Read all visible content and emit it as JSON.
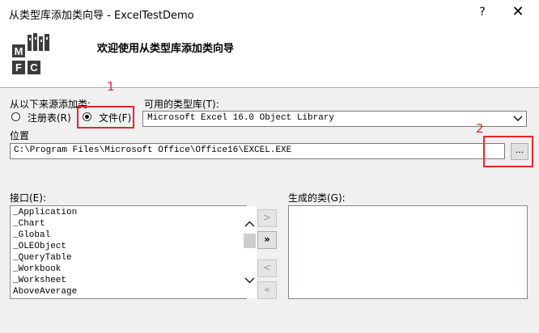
{
  "window": {
    "title": "从类型库添加类向导 - ExcelTestDemo",
    "help_glyph": "?",
    "close_glyph": "✕"
  },
  "header": {
    "title": "欢迎使用从类型库添加类向导",
    "logo_letters": [
      "M",
      "F",
      "C"
    ]
  },
  "source": {
    "label": "从以下来源添加类:",
    "options": [
      {
        "label": "注册表(R)",
        "checked": false
      },
      {
        "label": "文件(F)",
        "checked": true
      }
    ]
  },
  "library": {
    "label": "可用的类型库(T):",
    "selected": "Microsoft Excel 16.0 Object Library"
  },
  "location": {
    "label": "位置",
    "value": "C:\\Program Files\\Microsoft Office\\Office16\\EXCEL.EXE",
    "browse_label": "..."
  },
  "interfaces": {
    "label": "接口(E):",
    "items": [
      "_Application",
      "_Chart",
      "_Global",
      "_OLEObject",
      "_QueryTable",
      "_Workbook",
      "_Worksheet",
      "AboveAverage"
    ]
  },
  "generated": {
    "label": "生成的类(G):",
    "items": []
  },
  "move_buttons": [
    ">",
    "»",
    "<",
    "«"
  ],
  "scroll": {
    "up": "∧",
    "down": "∨"
  },
  "annotations": [
    "1",
    "2"
  ],
  "colors": {
    "annotation": "#e8262b",
    "dialog_bg": "#f0f0f0"
  }
}
